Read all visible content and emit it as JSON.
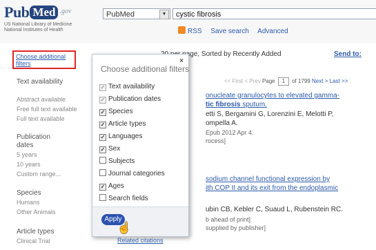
{
  "header": {
    "logo_pub": "Pub",
    "logo_med": "Med",
    "logo_gov": ".gov",
    "institution_line1": "US National Library of Medicine",
    "institution_line2": "National Institutes of Health",
    "database_value": "PubMed",
    "query_value": "cystic fibrosis",
    "links": [
      "RSS",
      "Save search",
      "Advanced"
    ]
  },
  "colors": {
    "brand": "#25457e",
    "link": "#2c5aa8",
    "highlight": "#e02424",
    "apply": "#2c52b0"
  },
  "sidebar": {
    "choose_link": "Choose additional filters",
    "sections": [
      {
        "title": "Text availability",
        "items": [
          "Abstract available",
          "Free full text available",
          "Full text available"
        ]
      },
      {
        "title": "Publication dates",
        "items": [
          "5 years",
          "10 years",
          "Custom range..."
        ]
      },
      {
        "title": "Species",
        "items": [
          "Humans",
          "Other Animals"
        ]
      },
      {
        "title": "Article types",
        "items": [
          "Clinical Trial"
        ]
      }
    ]
  },
  "results": {
    "display_settings": "20 per page, Sorted by Recently Added",
    "send_to": "Send to:",
    "pager": {
      "first": "<< First",
      "prev": "< Prev",
      "page_label": "Page",
      "page": "1",
      "of": "of 1799",
      "next": "Next >",
      "last": "Last >>"
    },
    "lines": [
      "onucleate granulocytes to elevated gamma-",
      "tic fibrosis",
      "sputum.",
      "etti S, Bergamini G, Lorenzini E, Melotti P,",
      "ompella A.",
      "Epub 2012 Apr 4.",
      "rocess]",
      "sodium channel functional expression by",
      "ith COP II and its exit from the endoplasmic",
      "ubin CB, Kebler C, Suaud L, Rubenstein RC.",
      "b ahead of print]",
      "supplied by publisher]"
    ]
  },
  "popup": {
    "title": "Choose additional filters",
    "close": "×",
    "options": [
      {
        "label": "Text availability",
        "checked": true,
        "disabled": true
      },
      {
        "label": "Publication dates",
        "checked": true,
        "disabled": true
      },
      {
        "label": "Species",
        "checked": true,
        "disabled": false
      },
      {
        "label": "Article types",
        "checked": true,
        "disabled": false
      },
      {
        "label": "Languages",
        "checked": true,
        "disabled": false
      },
      {
        "label": "Sex",
        "checked": true,
        "disabled": false
      },
      {
        "label": "Subjects",
        "checked": false,
        "disabled": false
      },
      {
        "label": "Journal categories",
        "checked": false,
        "disabled": false
      },
      {
        "label": "Ages",
        "checked": true,
        "disabled": false
      },
      {
        "label": "Search fields",
        "checked": false,
        "disabled": false
      }
    ],
    "apply": "Apply",
    "related": "Related citations"
  }
}
